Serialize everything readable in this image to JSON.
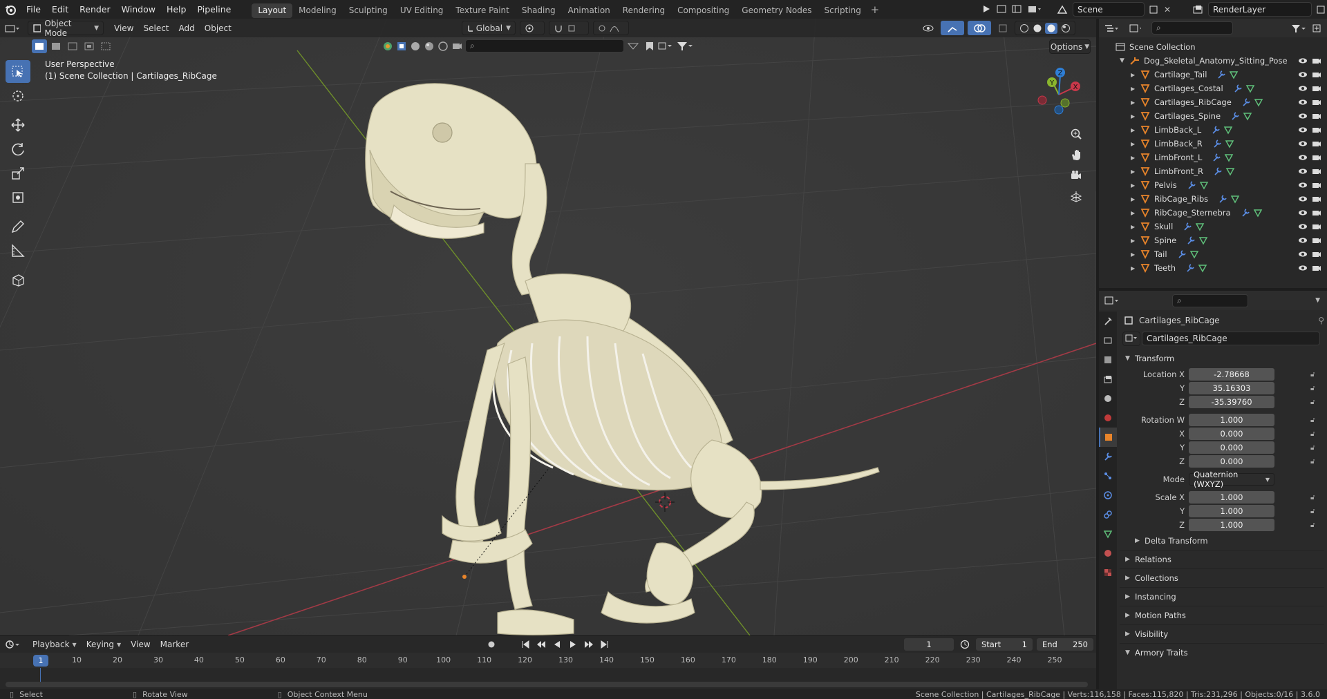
{
  "topbar": {
    "menus": [
      "File",
      "Edit",
      "Render",
      "Window",
      "Help",
      "Pipeline"
    ],
    "workspaces": [
      "Layout",
      "Modeling",
      "Sculpting",
      "UV Editing",
      "Texture Paint",
      "Shading",
      "Animation",
      "Rendering",
      "Compositing",
      "Geometry Nodes",
      "Scripting"
    ],
    "active_workspace": "Layout",
    "scene": "Scene",
    "view_layer": "RenderLayer"
  },
  "viewport": {
    "mode": "Object Mode",
    "menus": [
      "View",
      "Select",
      "Add",
      "Object"
    ],
    "transform_orientation": "Global",
    "options_label": "Options",
    "perspective_label": "User Perspective",
    "collection_label": "(1) Scene Collection | Cartilages_RibCage",
    "gizmo_axes": [
      "X",
      "Y",
      "Z"
    ]
  },
  "outliner": {
    "root": "Scene Collection",
    "armature": "Dog_Skeletal_Anatomy_Sitting_Pose",
    "objects": [
      {
        "name": "Cartilage_Tail",
        "selected": false
      },
      {
        "name": "Cartilages_Costal",
        "selected": false
      },
      {
        "name": "Cartilages_RibCage",
        "selected": false
      },
      {
        "name": "Cartilages_Spine",
        "selected": false
      },
      {
        "name": "LimbBack_L",
        "selected": false
      },
      {
        "name": "LimbBack_R",
        "selected": false
      },
      {
        "name": "LimbFront_L",
        "selected": false
      },
      {
        "name": "LimbFront_R",
        "selected": false
      },
      {
        "name": "Pelvis",
        "selected": false
      },
      {
        "name": "RibCage_Ribs",
        "selected": false
      },
      {
        "name": "RibCage_Sternebra",
        "selected": false
      },
      {
        "name": "Skull",
        "selected": false
      },
      {
        "name": "Spine",
        "selected": false
      },
      {
        "name": "Tail",
        "selected": false
      },
      {
        "name": "Teeth",
        "selected": false
      }
    ]
  },
  "properties": {
    "object_name": "Cartilages_RibCage",
    "datablock_name": "Cartilages_RibCage",
    "transform_label": "Transform",
    "location": {
      "label": "Location X",
      "x": "-2.78668",
      "y": "35.16303",
      "z": "-35.39760"
    },
    "rotation": {
      "label": "Rotation W",
      "w": "1.000",
      "x": "0.000",
      "y": "0.000",
      "z": "0.000"
    },
    "mode_label": "Mode",
    "rotation_mode": "Quaternion (WXYZ)",
    "scale": {
      "label": "Scale X",
      "x": "1.000",
      "y": "1.000",
      "z": "1.000"
    },
    "axis_y": "Y",
    "axis_z": "Z",
    "axis_x": "X",
    "delta_transform": "Delta Transform",
    "panels": [
      "Relations",
      "Collections",
      "Instancing",
      "Motion Paths",
      "Visibility",
      "Armory Traits"
    ]
  },
  "timeline": {
    "menus": [
      "Playback",
      "Keying",
      "View",
      "Marker"
    ],
    "current_frame": "1",
    "start_label": "Start",
    "start": "1",
    "end_label": "End",
    "end": "250",
    "ticks": [
      "10",
      "20",
      "30",
      "40",
      "50",
      "60",
      "70",
      "80",
      "90",
      "100",
      "110",
      "120",
      "130",
      "140",
      "150",
      "160",
      "170",
      "180",
      "190",
      "200",
      "210",
      "220",
      "230",
      "240",
      "250"
    ],
    "playhead": "1"
  },
  "statusbar": {
    "select": "Select",
    "rotate": "Rotate View",
    "context": "Object Context Menu",
    "stats": "Scene Collection | Cartilages_RibCage | Verts:116,158 | Faces:115,820 | Tris:231,296 | Objects:0/16 | 3.6.0"
  },
  "colors": {
    "accent": "#4772b3",
    "axis_x": "#c8384a",
    "axis_y": "#8ab52d",
    "axis_z": "#2f7fd6",
    "bone": "#e6e1c4",
    "orange": "#e8842a"
  }
}
